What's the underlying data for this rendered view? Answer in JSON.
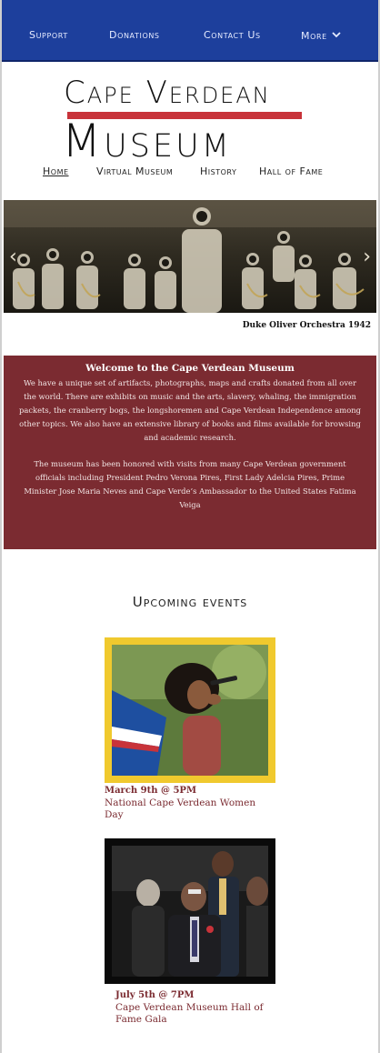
{
  "topnav": {
    "items": [
      "Support",
      "Donations",
      "Contact Us",
      "More"
    ],
    "background": "#1d3f9c"
  },
  "logo": {
    "line1": "Cape Verdean",
    "line2": "Museum",
    "accent": "#c8333a"
  },
  "mainnav": {
    "links": [
      "Home",
      "Virtual Museum",
      "History",
      "Hall of Fame"
    ],
    "active": "Home"
  },
  "slider": {
    "caption": "Duke Oliver Orchestra 1942",
    "prev_icon": "chevron-left-icon",
    "next_icon": "chevron-right-icon"
  },
  "welcome": {
    "title": "Welcome to the Cape Verdean Museum",
    "paragraph1": "We have a unique set of artifacts, photographs, maps and crafts donated from all over the world. There are exhibits on music and the arts, slavery, whaling, the immigration packets, the cranberry bogs,  the longshoremen and Cape Verdean Independence among other topics. We also have an extensive  library of books and films available for browsing and academic research.",
    "paragraph2": "The museum has been honored with visits from many Cape Verdean government officials including President Pedro Verona Pires, First Lady Adelcia Pires, Prime Minister Jose Maria Neves and Cape Verde’s Ambassador to the United States Fatima Veiga",
    "background": "#7b2b31"
  },
  "upcoming": {
    "heading": "Upcoming events",
    "events": [
      {
        "date": "March 9th @ 5PM",
        "title": "National Cape Verdean Women Day",
        "frame_color": "#f0c92e"
      },
      {
        "date": "July 5th @ 7PM",
        "title": "Cape Verdean Museum Hall of Fame Gala",
        "frame_color": "#0a0a0a"
      }
    ]
  }
}
